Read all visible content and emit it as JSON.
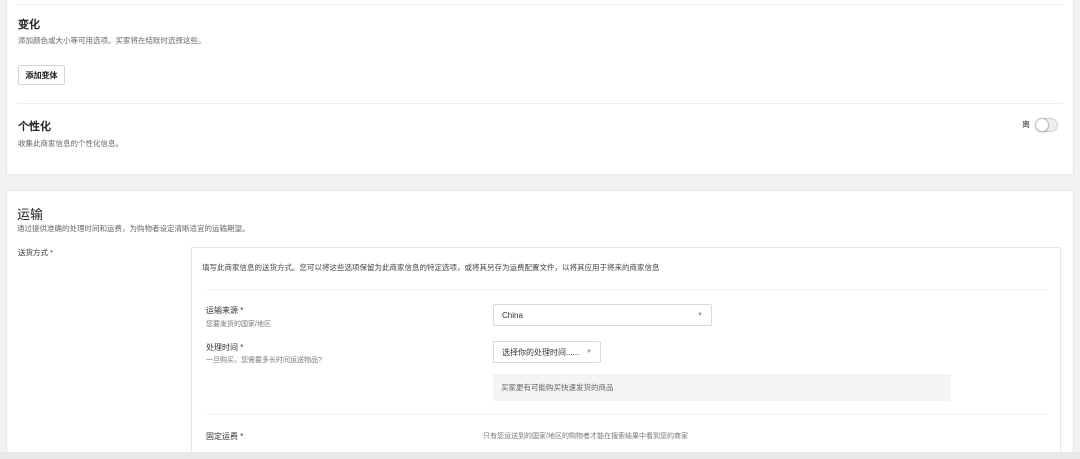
{
  "variations": {
    "title": "变化",
    "description": "添加颜色或大小等可用选项。买家将在结账时选择这些。",
    "add_button": "添加变体"
  },
  "personalization": {
    "title": "个性化",
    "description": "收集此商家信息的个性化信息。",
    "toggle_label": "离",
    "toggle_on": false
  },
  "shipping": {
    "title": "运输",
    "description": "通过提供准确的处理时间和运费，为购物者设定清晰适宜的运输期望。",
    "method_label": "送货方式 *",
    "intro": "填写此商家信息的送货方式。您可以将这些选项保留为此商家信息的特定选项，或将其另存为运费配置文件，以将其应用于将来的商家信息",
    "origin": {
      "label": "运输来源 *",
      "help": "您要发货的国家/地区",
      "value": "China"
    },
    "processing": {
      "label": "处理时间 *",
      "help": "一旦购买，您需要多长时间运送物品?",
      "value": "选择你的处理时间......",
      "hint": "买家更有可能购买快速发货的商品"
    },
    "fixed_cost": {
      "label": "固定运费 *",
      "note": "只有您运送到的国家/地区的购物者才能在搜索结果中看到您的商家"
    }
  }
}
